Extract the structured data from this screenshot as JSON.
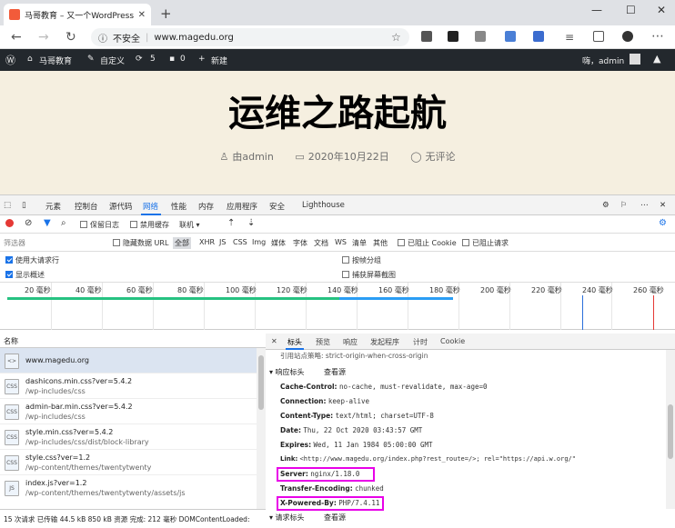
{
  "browser": {
    "tab_title": "马哥教育 – 又一个WordPress站点",
    "security": "不安全",
    "url": "www.magedu.org"
  },
  "wp_admin_bar": {
    "site_name": "马哥教育",
    "customize": "自定义",
    "updates": "5",
    "comments": "0",
    "new": "新建",
    "greeting": "嗨，admin"
  },
  "post": {
    "title": "运维之路起航",
    "author": "由admin",
    "date": "2020年10月22日",
    "comments": "无评论"
  },
  "devtools": {
    "tabs": [
      "元素",
      "控制台",
      "源代码",
      "网络",
      "性能",
      "内存",
      "应用程序",
      "安全",
      "Lighthouse"
    ],
    "toolbar": {
      "preserve_log": "保留日志",
      "disable_cache": "禁用缓存",
      "throttle": "联机"
    },
    "filter": {
      "placeholder": "筛选器",
      "hide_data_url": "隐藏数据 URL",
      "types": [
        "全部",
        "XHR",
        "JS",
        "CSS",
        "Img",
        "媒体",
        "字体",
        "文档",
        "WS",
        "清单",
        "其他"
      ],
      "blocked_cookies": "已阻止 Cookie",
      "blocked_requests": "已阻止请求"
    },
    "options": {
      "large_rows": "使用大请求行",
      "overview": "显示概述",
      "group_by_frame": "按帧分组",
      "screenshots": "捕获屏幕截图"
    },
    "timeline_ticks": [
      "20 毫秒",
      "40 毫秒",
      "60 毫秒",
      "80 毫秒",
      "100 毫秒",
      "120 毫秒",
      "140 毫秒",
      "160 毫秒",
      "180 毫秒",
      "200 毫秒",
      "220 毫秒",
      "240 毫秒",
      "260 毫秒"
    ],
    "list_header": "名称",
    "requests": [
      {
        "icon": "<>",
        "name": "www.magedu.org",
        "path": ""
      },
      {
        "icon": "CSS",
        "name": "dashicons.min.css?ver=5.4.2",
        "path": "/wp-includes/css"
      },
      {
        "icon": "CSS",
        "name": "admin-bar.min.css?ver=5.4.2",
        "path": "/wp-includes/css"
      },
      {
        "icon": "CSS",
        "name": "style.min.css?ver=5.4.2",
        "path": "/wp-includes/css/dist/block-library"
      },
      {
        "icon": "CSS",
        "name": "style.css?ver=1.2",
        "path": "/wp-content/themes/twentytwenty"
      },
      {
        "icon": "JS",
        "name": "index.js?ver=1.2",
        "path": "/wp-content/themes/twentytwenty/assets/js"
      }
    ],
    "status_bar": "15 次请求  已传输 44.5 kB  850 kB 资源  完成: 212 毫秒  DOMContentLoaded:",
    "detail_tabs": [
      "标头",
      "预览",
      "响应",
      "发起程序",
      "计时",
      "Cookie"
    ],
    "referrer_line": "引用站点策略: strict-origin-when-cross-origin",
    "response_headers_title": "▾ 响应标头",
    "view_source": "查看源",
    "headers": [
      {
        "k": "Cache-Control:",
        "v": "no-cache, must-revalidate, max-age=0"
      },
      {
        "k": "Connection:",
        "v": "keep-alive"
      },
      {
        "k": "Content-Type:",
        "v": "text/html; charset=UTF-8"
      },
      {
        "k": "Date:",
        "v": "Thu, 22 Oct 2020 03:43:57 GMT"
      },
      {
        "k": "Expires:",
        "v": "Wed, 11 Jan 1984 05:00:00 GMT"
      },
      {
        "k": "Link:",
        "v": "<http://www.magedu.org/index.php?rest_route=/>; rel=\"https://api.w.org/\""
      },
      {
        "k": "Server:",
        "v": "nginx/1.18.0"
      },
      {
        "k": "Transfer-Encoding:",
        "v": "chunked"
      },
      {
        "k": "X-Powered-By:",
        "v": "PHP/7.4.11"
      }
    ],
    "request_headers_title": "▾ 请求标头",
    "view_source2": "查看源",
    "highlight_color": "#e800e8"
  }
}
